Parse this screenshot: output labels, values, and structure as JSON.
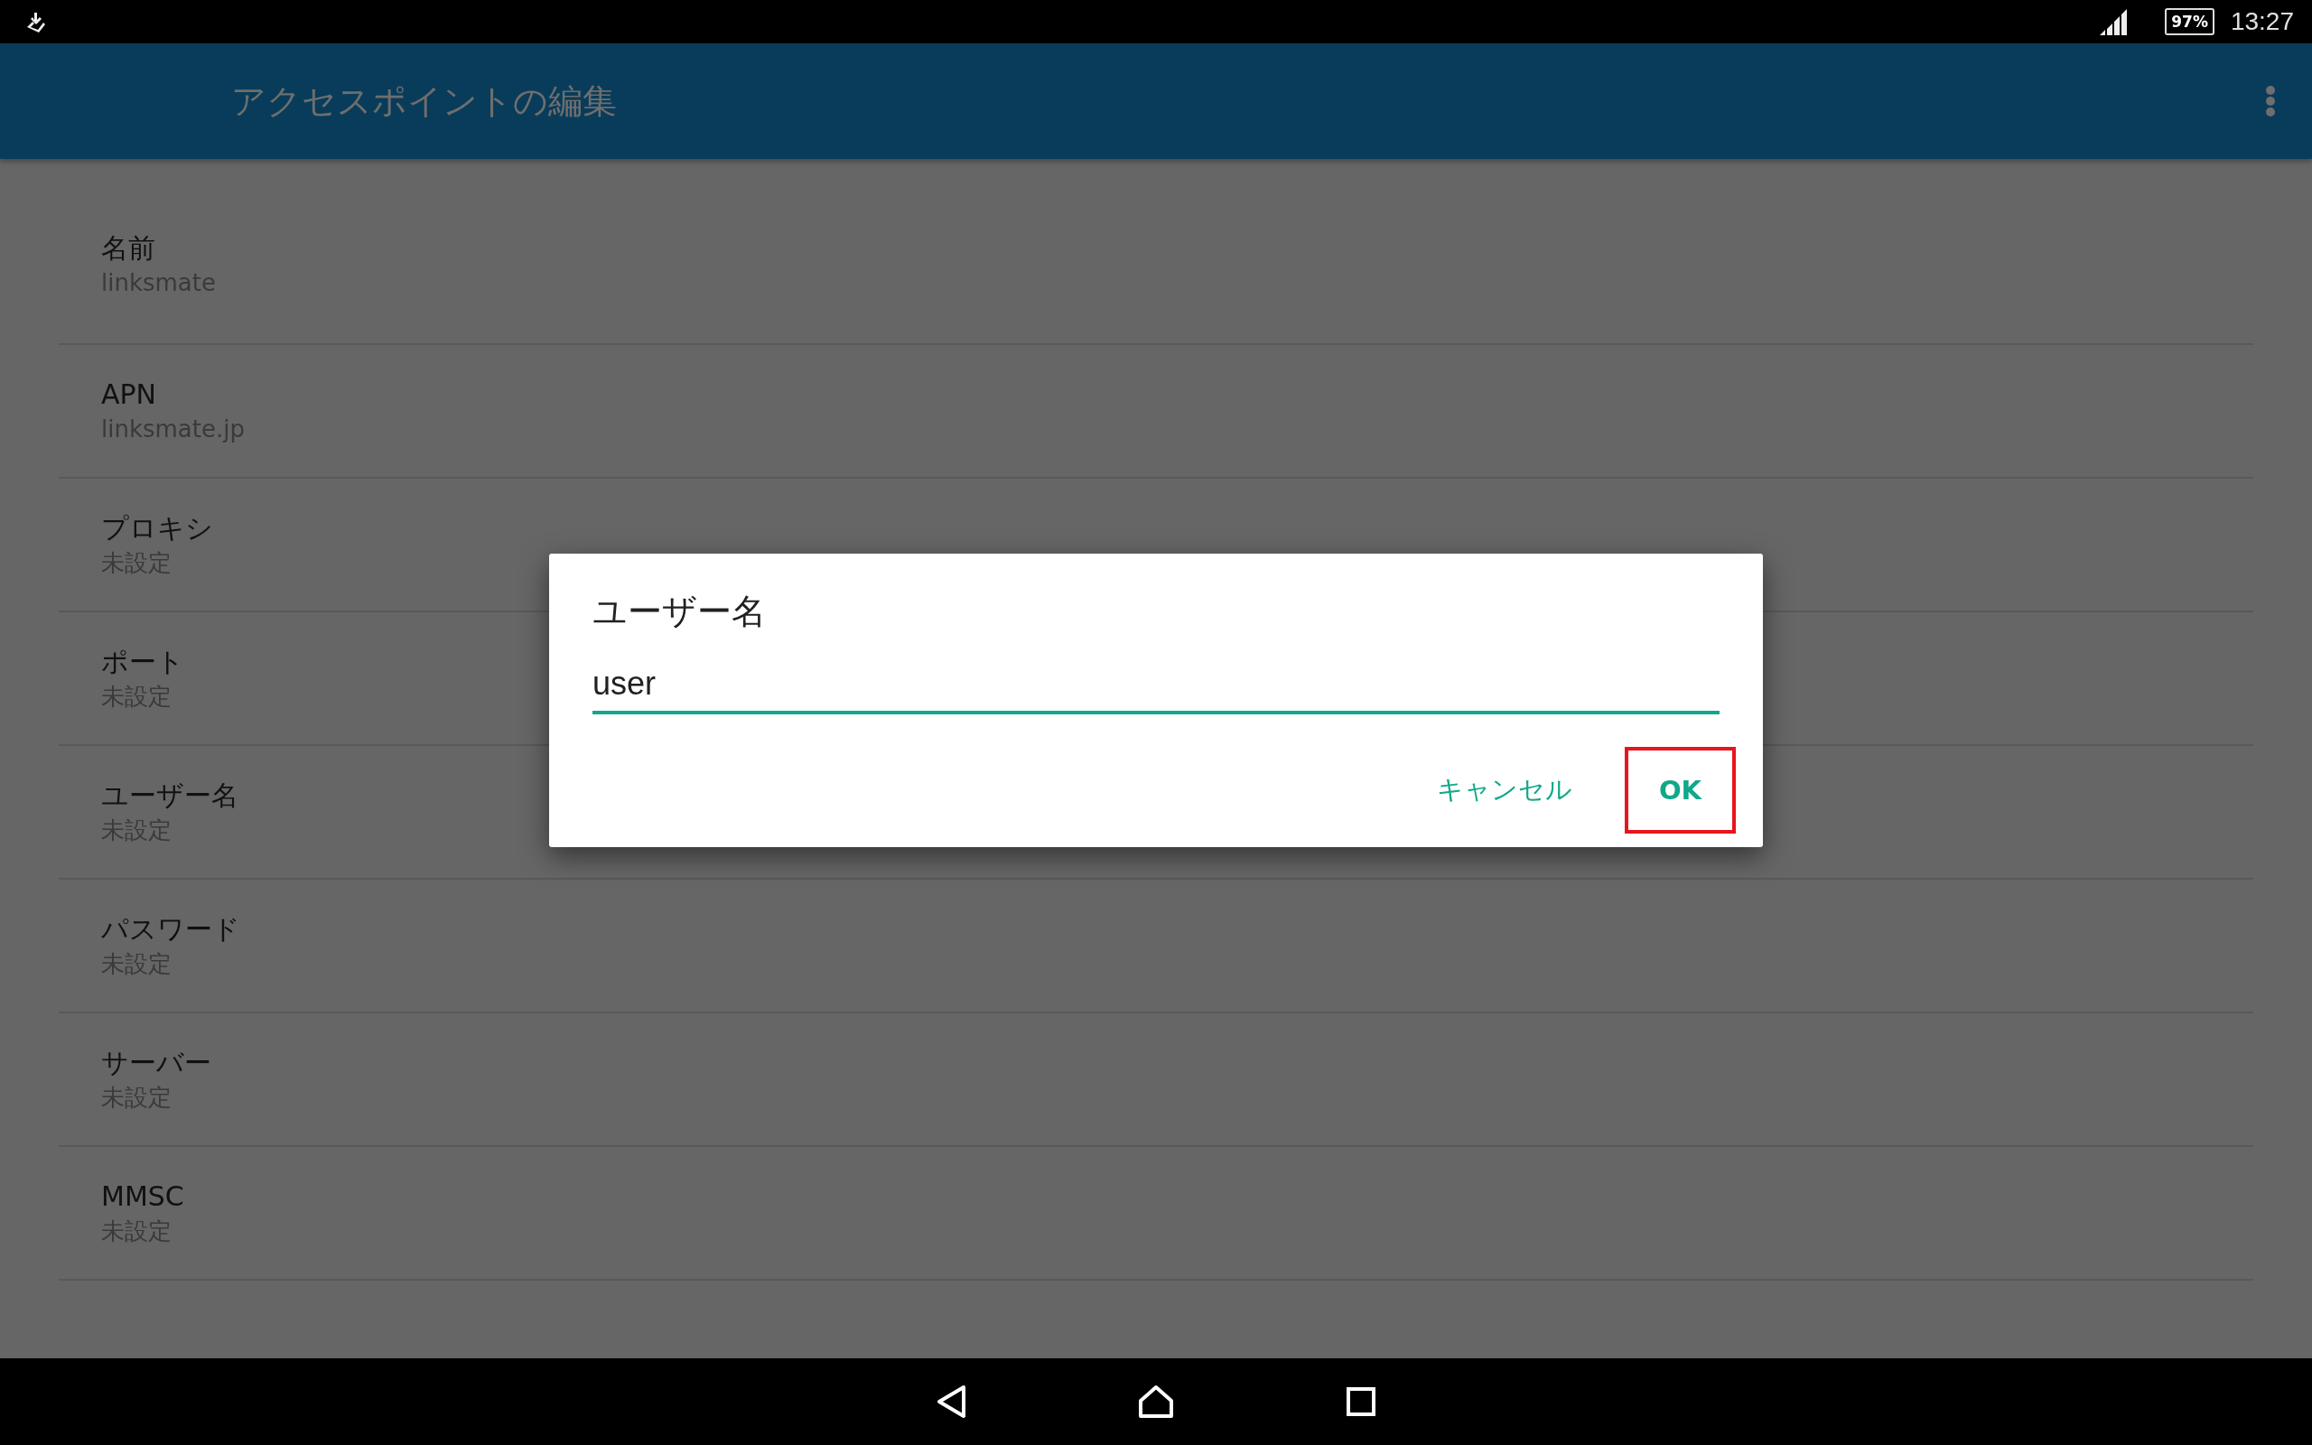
{
  "status_bar": {
    "battery": "97%",
    "time": "13:27"
  },
  "app_bar": {
    "title": "アクセスポイントの編集"
  },
  "settings": [
    {
      "title": "名前",
      "summary": "linksmate"
    },
    {
      "title": "APN",
      "summary": "linksmate.jp"
    },
    {
      "title": "プロキシ",
      "summary": "未設定"
    },
    {
      "title": "ポート",
      "summary": "未設定"
    },
    {
      "title": "ユーザー名",
      "summary": "未設定"
    },
    {
      "title": "パスワード",
      "summary": "未設定"
    },
    {
      "title": "サーバー",
      "summary": "未設定"
    },
    {
      "title": "MMSC",
      "summary": "未設定"
    }
  ],
  "dialog": {
    "title": "ユーザー名",
    "value": "user",
    "buttons": [
      {
        "label": "キャンセル",
        "highlighted": false
      },
      {
        "label": "OK",
        "highlighted": true
      }
    ]
  }
}
